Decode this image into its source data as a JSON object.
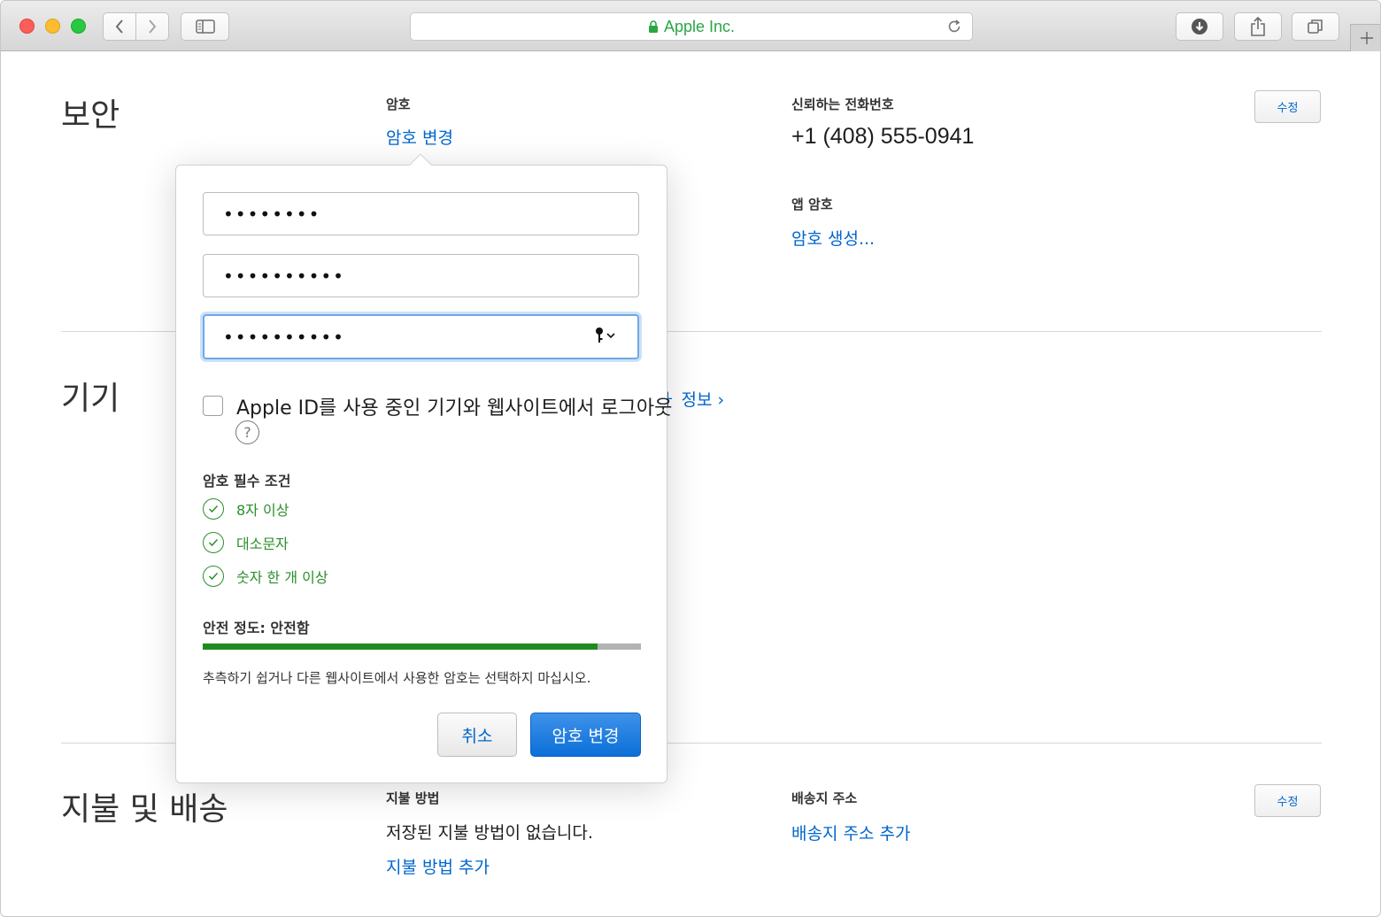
{
  "browser": {
    "url_text": "Apple Inc."
  },
  "security": {
    "title": "보안",
    "password_label": "암호",
    "change_password_link": "암호 변경",
    "trusted_phone_label": "신뢰하는 전화번호",
    "trusted_phone_value": "+1 (408) 555-0941",
    "app_password_label": "앱 암호",
    "generate_password_link": "암호 생성...",
    "edit_label": "수정"
  },
  "devices": {
    "title": "기기",
    "partial_link": "ㅏ 정보 ›"
  },
  "payment": {
    "title": "지불 및 배송",
    "payment_method_label": "지불 방법",
    "no_payment_text": "저장된 지불 방법이 없습니다.",
    "add_payment_link": "지불 방법 추가",
    "shipping_label": "배송지 주소",
    "add_shipping_link": "배송지 주소 추가",
    "edit_label": "수정"
  },
  "popover": {
    "current_password_dots": "••••••••",
    "new_password_dots": "••••••••••",
    "confirm_password_dots": "••••••••••",
    "logout_checkbox_label": "Apple ID를 사용 중인 기기와 웹사이트에서 로그아웃",
    "help_glyph": "?",
    "requirements_title": "암호 필수 조건",
    "requirements": [
      {
        "text": "8자 이상",
        "met": true
      },
      {
        "text": "대소문자",
        "met": true
      },
      {
        "text": "숫자 한 개 이상",
        "met": true
      }
    ],
    "strength_label": "안전 정도: 안전함",
    "strength_level": 0.9,
    "hint": "추측하기 쉽거나 다른 웹사이트에서 사용한 암호는 선택하지 마십시오.",
    "cancel_label": "취소",
    "submit_label": "암호 변경"
  },
  "colors": {
    "link": "#0066cc",
    "success": "#2b8f2b",
    "strength_fill": "#208a20",
    "primary_button": "#0b6fd8"
  }
}
